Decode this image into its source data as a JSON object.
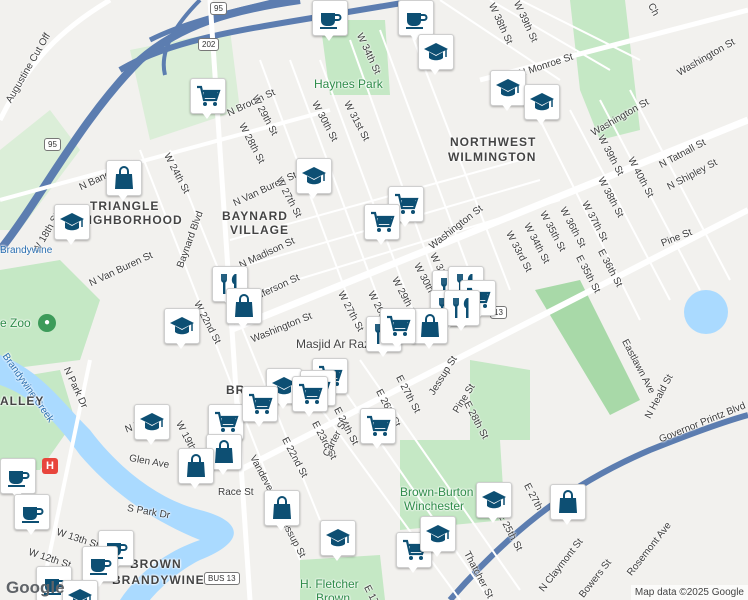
{
  "map": {
    "labels": {
      "augustine": "Augustine Cut Off",
      "n_broom": "N Broom St",
      "haynes_park": "Haynes Park",
      "w34th": "W 34th St",
      "w38th": "W 38th St",
      "w39th": "W 39th St",
      "n_monroe": "N Monroe St",
      "washington_st_ne": "Washington St",
      "northwest_1": "NORTHWEST",
      "northwest_2": "WILMINGTON",
      "w29th_top": "W 29th St",
      "w28th_top": "W 28th St",
      "w30th_top": "W 30th St",
      "w31st_top": "W 31st St",
      "w24th": "W 24th St",
      "n_bancroft": "N Bancroft St",
      "triangle_1": "TRIANGLE",
      "triangle_2": "NEIGHBORHOOD",
      "w18th": "W 18th St",
      "n_van_buren_top": "N Van Buren St",
      "w27th": "W 27th St",
      "baynard_1": "BAYNARD",
      "baynard_2": "VILLAGE",
      "baynard_blvd": "Baynard Blvd",
      "n_van_buren": "N Van Buren St",
      "n_madison": "N Madison St",
      "n_jefferson": "N Jefferson St",
      "w22nd": "W 22nd St",
      "washington_st_mid": "Washington St",
      "washington_st_upper": "Washington St",
      "w39th_r": "W 39th St",
      "w38th_r": "W 38th St",
      "w40th": "W 40th St",
      "tatnall": "N Tatnall St",
      "shipley": "N Shipley St",
      "w37th": "W 37th St",
      "w36th": "W 36th St",
      "w35th": "W 35th St",
      "w34th_r": "W 34th St",
      "w33rd": "W 33rd St",
      "pine_st_r": "Pine St",
      "e36th": "E 36th St",
      "e35th": "E 35th St",
      "eastlawn": "Eastlawn Ave",
      "n_heald": "N Heald St",
      "gov_printz": "Governor Printz Blvd",
      "w31st_mid": "W 31st St",
      "w30th_mid": "W 30th St",
      "w29th_mid": "W 29th St",
      "w27th_mid": "W 27th St",
      "w26th_mid": "W 26th St",
      "masjid": "Masjid Ar Razzaq",
      "jessup": "Jessup St",
      "pine_st_mid": "Pine St",
      "e27th": "E 27th St",
      "e26th": "E 26th St",
      "e28th": "E 28th St",
      "e24th": "E 24th St",
      "e23rd": "E 23rd St",
      "e22nd": "E 22nd St",
      "vandever": "Vandever Ave",
      "carter": "Carter St",
      "race": "Race St",
      "glen": "Glen Ave",
      "s_park": "S Park Dr",
      "n_park": "N Park Dr",
      "n_west": "N West St",
      "w19th": "W 19th St",
      "w13th": "W 13th St",
      "w12th": "W 12th St",
      "brandywine_creek": "Brandywine Creek",
      "brandywine_top": "Brandywine",
      "zoo": "e Zoo",
      "valley": "ALLEY",
      "brown": "BROWN",
      "brandywine": "BRANDYWINE",
      "brown_burton_1": "Brown-Burton",
      "brown_burton_2": "Winchester",
      "h_fletcher_1": "H. Fletcher",
      "h_fletcher_2": "Brown",
      "e27th_b": "E 27th",
      "e25th": "E 25th St",
      "thatcher": "Thatcher St",
      "n_claymont": "N Claymont St",
      "bowers": "Bowers St",
      "rosemont": "Rosemont Ave",
      "e17th": "E 17th",
      "br": "BR",
      "chu": "Ch",
      "washington_ne": "Washington St"
    },
    "shields": {
      "i95": "95",
      "us202": "202",
      "i95b": "95",
      "us13": "13",
      "bus13": "BUS 13"
    },
    "hospital_label": "H",
    "zoo_icon": "paw-icon",
    "attribution": "Map data ©2025 Google",
    "google_logo": "Google",
    "colors": {
      "pin_blue": "#0d4f73",
      "park_green": "#c5e8c5",
      "water": "#aadaff",
      "highway": "#5c7db0",
      "major_road": "#ffffff"
    }
  },
  "pins": [
    {
      "type": "coffee",
      "icon": "coffee-cup-icon"
    },
    {
      "type": "coffee",
      "icon": "coffee-cup-icon"
    },
    {
      "type": "school",
      "icon": "graduation-cap-icon"
    },
    {
      "type": "grocery",
      "icon": "shopping-cart-icon"
    },
    {
      "type": "school",
      "icon": "graduation-cap-icon"
    },
    {
      "type": "school",
      "icon": "graduation-cap-icon"
    },
    {
      "type": "shop",
      "icon": "shopping-bag-icon"
    },
    {
      "type": "school",
      "icon": "graduation-cap-icon"
    },
    {
      "type": "school",
      "icon": "graduation-cap-icon"
    },
    {
      "type": "grocery",
      "icon": "shopping-cart-icon"
    },
    {
      "type": "grocery",
      "icon": "shopping-cart-icon"
    },
    {
      "type": "restaurant",
      "icon": "fork-knife-icon"
    },
    {
      "type": "shop",
      "icon": "shopping-bag-icon"
    },
    {
      "type": "school",
      "icon": "graduation-cap-icon"
    },
    {
      "type": "restaurant",
      "icon": "fork-knife-icon"
    },
    {
      "type": "restaurant",
      "icon": "fork-knife-icon"
    },
    {
      "type": "grocery",
      "icon": "shopping-cart-icon"
    },
    {
      "type": "restaurant",
      "icon": "fork-knife-icon"
    },
    {
      "type": "restaurant",
      "icon": "fork-knife-icon"
    },
    {
      "type": "shop",
      "icon": "shopping-bag-icon"
    },
    {
      "type": "restaurant",
      "icon": "fork-knife-icon"
    },
    {
      "type": "grocery",
      "icon": "shopping-cart-icon"
    },
    {
      "type": "grocery",
      "icon": "shopping-cart-icon"
    },
    {
      "type": "school",
      "icon": "graduation-cap-icon"
    },
    {
      "type": "grocery",
      "icon": "shopping-cart-icon"
    },
    {
      "type": "grocery",
      "icon": "shopping-cart-icon"
    },
    {
      "type": "school",
      "icon": "graduation-cap-icon"
    },
    {
      "type": "grocery",
      "icon": "shopping-cart-icon"
    },
    {
      "type": "grocery",
      "icon": "shopping-cart-icon"
    },
    {
      "type": "shop",
      "icon": "shopping-bag-icon"
    },
    {
      "type": "shop",
      "icon": "shopping-bag-icon"
    },
    {
      "type": "coffee",
      "icon": "coffee-cup-icon"
    },
    {
      "type": "coffee",
      "icon": "coffee-cup-icon"
    },
    {
      "type": "coffee",
      "icon": "coffee-cup-icon"
    },
    {
      "type": "coffee",
      "icon": "coffee-cup-icon"
    },
    {
      "type": "coffee",
      "icon": "coffee-cup-icon"
    },
    {
      "type": "shop",
      "icon": "shopping-bag-icon"
    },
    {
      "type": "school",
      "icon": "graduation-cap-icon"
    },
    {
      "type": "school",
      "icon": "graduation-cap-icon"
    },
    {
      "type": "grocery",
      "icon": "shopping-cart-icon"
    },
    {
      "type": "school",
      "icon": "graduation-cap-icon"
    },
    {
      "type": "shop",
      "icon": "shopping-bag-icon"
    },
    {
      "type": "grocery",
      "icon": "shopping-cart-icon"
    },
    {
      "type": "school",
      "icon": "graduation-cap-icon"
    }
  ]
}
